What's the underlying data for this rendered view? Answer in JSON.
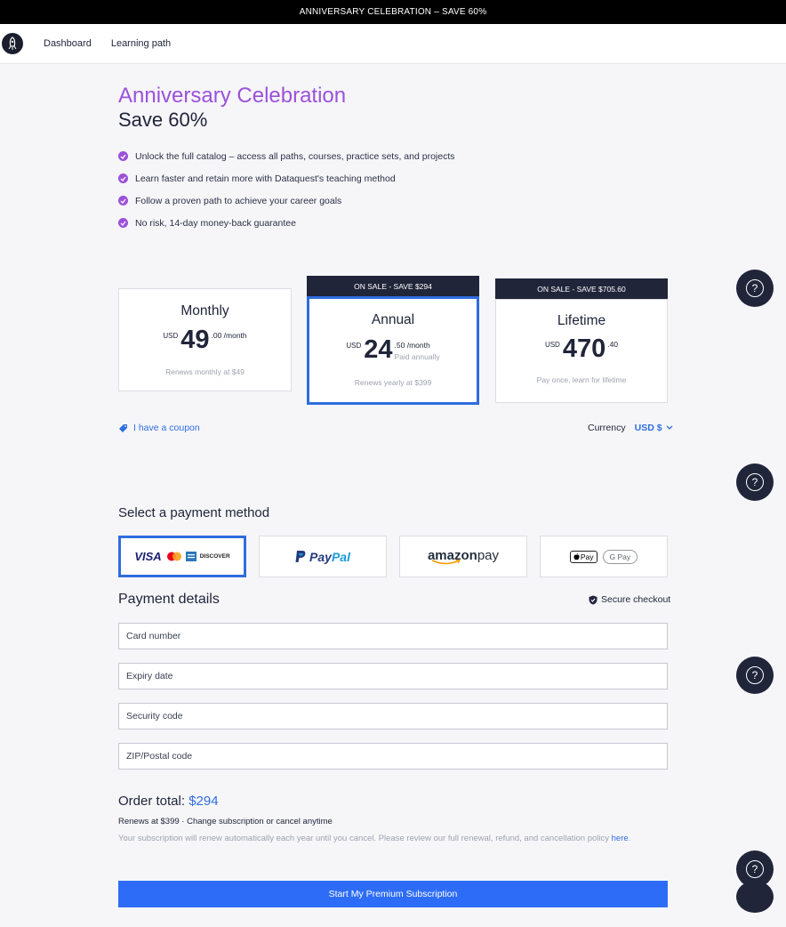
{
  "banner": "ANNIVERSARY CELEBRATION – SAVE 60%",
  "nav": {
    "logo_icon": "rocket-icon",
    "items": [
      "Dashboard",
      "Learning path"
    ]
  },
  "hero": {
    "title": "Anniversary Celebration",
    "subtitle": "Save 60%",
    "benefits": [
      "Unlock the full catalog – access all paths, courses, practice sets, and projects",
      "Learn faster and retain more with Dataquest's teaching method",
      "Follow a proven path to achieve your career goals",
      "No risk, 14-day money-back guarantee"
    ]
  },
  "plans": {
    "monthly": {
      "name": "Monthly",
      "currency": "USD",
      "whole": "49",
      "fraction": ".00 /month",
      "note": "Renews monthly at $49"
    },
    "annual": {
      "ribbon": "ON SALE - SAVE $294",
      "name": "Annual",
      "currency": "USD",
      "whole": "24",
      "fraction": ".50 /month",
      "sub": "Paid annually",
      "note": "Renews yearly at $399",
      "selected": true
    },
    "lifetime": {
      "ribbon": "ON SALE - SAVE $705.60",
      "name": "Lifetime",
      "currency": "USD",
      "whole": "470",
      "fraction": ".40",
      "note": "Pay once, learn for lifetime"
    }
  },
  "coupon": {
    "label": "I have a coupon"
  },
  "currency": {
    "label": "Currency",
    "value": "USD $"
  },
  "payment": {
    "title": "Select a payment method",
    "methods": {
      "card": {
        "visa": "VISA",
        "discover": "DISCOVER",
        "selected": true
      },
      "paypal": {
        "pay": "Pay",
        "pal": "Pal"
      },
      "amazon": {
        "amazon": "amazon",
        "pay": " pay"
      },
      "wallets": {
        "apple": "Pay",
        "google": "G Pay"
      }
    }
  },
  "details": {
    "title": "Payment details",
    "secure": "Secure checkout",
    "fields": {
      "card": "Card number",
      "expiry": "Expiry date",
      "security": "Security code",
      "zip": "ZIP/Postal code"
    }
  },
  "order": {
    "label": "Order total:",
    "amount": "$294",
    "renews": "Renews at $399 · Change subscription or cancel anytime",
    "policy": "Your subscription will renew automatically each year until you cancel. Please review our full renewal, refund, and cancellation policy",
    "policy_link": "here",
    "policy_end": "."
  },
  "cta": "Start My Premium Subscription",
  "help": {
    "glyph": "?"
  },
  "colors": {
    "accent": "#9b51d9",
    "primary": "#2d6cf6",
    "dark": "#21253a"
  }
}
